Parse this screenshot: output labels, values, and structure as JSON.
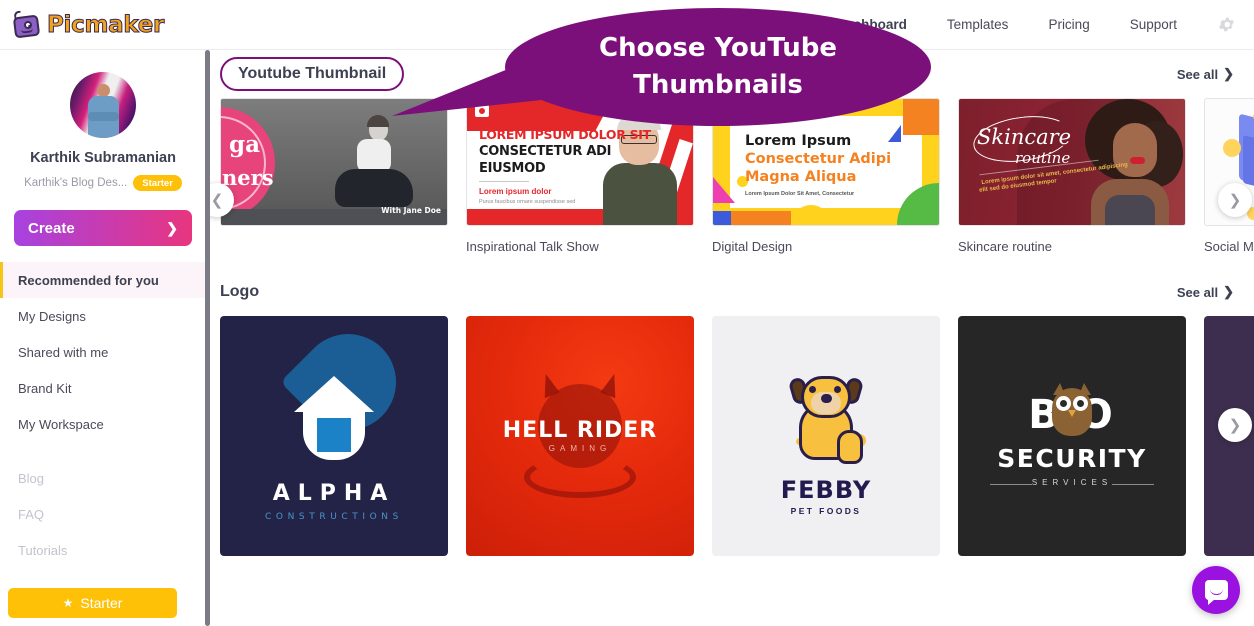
{
  "brand": {
    "name": "Picmaker",
    "logo_icon": "picmaker-robot-icon"
  },
  "topnav": {
    "items": [
      {
        "label": "Dashboard",
        "active": true
      },
      {
        "label": "Templates",
        "active": false
      },
      {
        "label": "Pricing",
        "active": false
      },
      {
        "label": "Support",
        "active": false
      }
    ],
    "settings_icon": "gear-icon"
  },
  "sidebar": {
    "user_name": "Karthik Subramanian",
    "workspace": "Karthik's Blog Des...",
    "plan_badge": "Starter",
    "create_label": "Create",
    "create_chevron": "chevron-right-icon",
    "items": [
      {
        "label": "Recommended for you",
        "state": "active"
      },
      {
        "label": "My Designs",
        "state": "normal"
      },
      {
        "label": "Shared with me",
        "state": "normal"
      },
      {
        "label": "Brand Kit",
        "state": "normal"
      },
      {
        "label": "My Workspace",
        "state": "normal"
      },
      {
        "label": "Blog",
        "state": "muted"
      },
      {
        "label": "FAQ",
        "state": "muted"
      },
      {
        "label": "Tutorials",
        "state": "muted"
      }
    ],
    "upgrade_button": {
      "label": "Starter",
      "icon": "star-icon"
    }
  },
  "callout": {
    "line1": "Choose YouTube",
    "line2": "Thumbnails",
    "color": "#7b107b"
  },
  "sections": [
    {
      "title": "Youtube Thumbnail",
      "highlighted": true,
      "see_all": "See all",
      "see_all_icon": "chevron-right-icon",
      "cards": [
        {
          "label": "",
          "art": "yoga-thumbnail",
          "texts": [
            "ga",
            "ners",
            "With Jane Doe"
          ]
        },
        {
          "label": "Inspirational Talk Show",
          "art": "talk-show-thumbnail",
          "texts": [
            "LOREM IPSUM DOLOR SIT",
            "CONSECTETUR ADI",
            "EIUSMOD",
            "Lorem ipsum dolor",
            "Purus faucibus ornare suspendisse sed"
          ]
        },
        {
          "label": "Digital Design",
          "art": "digital-design-thumbnail",
          "texts": [
            "Lorem Ipsum",
            "Consectetur Adipi",
            "Magna Aliqua",
            "Lorem Ipsum Dolor Sit Amet, Consectetur"
          ]
        },
        {
          "label": "Skincare routine",
          "art": "skincare-thumbnail",
          "texts": [
            "Skincare",
            "routine",
            "Lorem ipsum dolor sit amet, consectetur adipiscing",
            "elit sed do eiusmod tempor"
          ]
        },
        {
          "label": "Social Media Str",
          "art": "social-media-thumbnail",
          "texts": []
        }
      ],
      "prev_icon": "chevron-left-icon",
      "next_icon": "chevron-right-icon"
    },
    {
      "title": "Logo",
      "highlighted": false,
      "see_all": "See all",
      "see_all_icon": "chevron-right-icon",
      "cards": [
        {
          "label": "",
          "art": "alpha-constructions-logo",
          "texts": [
            "ALPHA",
            "CONSTRUCTIONS"
          ]
        },
        {
          "label": "",
          "art": "hell-rider-logo",
          "texts": [
            "HELL RIDER",
            "GAMING"
          ]
        },
        {
          "label": "",
          "art": "febby-pet-foods-logo",
          "texts": [
            "FEBBY",
            "PET FOODS"
          ]
        },
        {
          "label": "",
          "art": "boo-security-logo",
          "texts": [
            "B O",
            "SECURITY",
            "SERVICES"
          ]
        },
        {
          "label": "",
          "art": "partial-logo",
          "texts": []
        }
      ],
      "prev_icon": "chevron-left-icon",
      "next_icon": "chevron-right-icon"
    }
  ],
  "chat": {
    "icon": "chat-bubble-icon",
    "color": "#9912e0"
  }
}
